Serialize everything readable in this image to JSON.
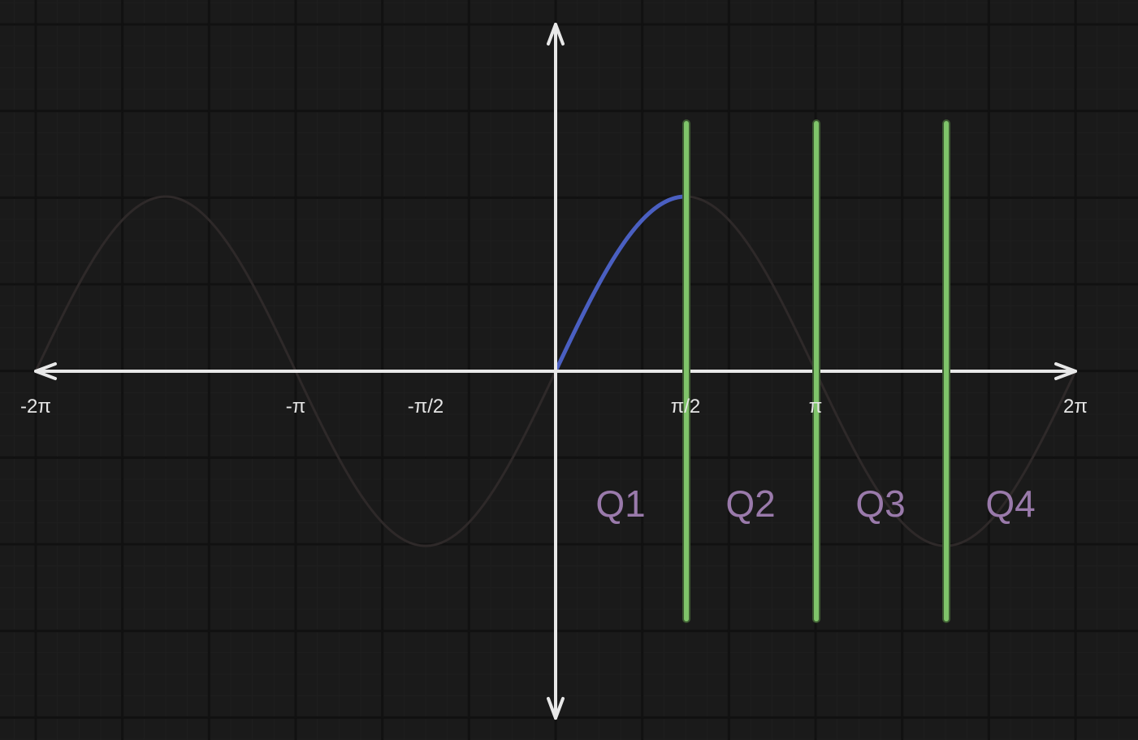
{
  "chart_data": {
    "type": "line",
    "function": "sin(x)",
    "xlim": [
      -6.2832,
      6.2832
    ],
    "ylim": [
      -1,
      1
    ],
    "x_ticks": [
      {
        "value": -6.2832,
        "label": "-2π"
      },
      {
        "value": -3.1416,
        "label": "-π"
      },
      {
        "value": -1.5708,
        "label": "-π/2"
      },
      {
        "value": 1.5708,
        "label": "π/2"
      },
      {
        "value": 3.1416,
        "label": "π"
      },
      {
        "value": 6.2832,
        "label": "2π"
      }
    ],
    "series": [
      {
        "role": "full-curve",
        "x_range": [
          -6.2832,
          6.2832
        ],
        "color": "#2e2929"
      },
      {
        "role": "highlighted-segment",
        "x_range": [
          0,
          1.5708
        ],
        "color": "#4a5fc1"
      }
    ],
    "dividers": [
      {
        "x": 1.5708,
        "color": "#7fc46a"
      },
      {
        "x": 3.1416,
        "color": "#7fc46a"
      },
      {
        "x": 4.7124,
        "color": "#7fc46a"
      }
    ],
    "regions": [
      {
        "label": "Q1",
        "x_center": 0.7854
      },
      {
        "label": "Q2",
        "x_center": 2.3562
      },
      {
        "label": "Q3",
        "x_center": 3.927
      },
      {
        "label": "Q4",
        "x_center": 5.4978
      }
    ],
    "grid": true
  },
  "colors": {
    "background": "#1a1a1a",
    "grid_major": "#111111",
    "grid_minor": "#1f1f1f",
    "axis": "#e8e8e8",
    "region_label": "#9a7aab"
  }
}
